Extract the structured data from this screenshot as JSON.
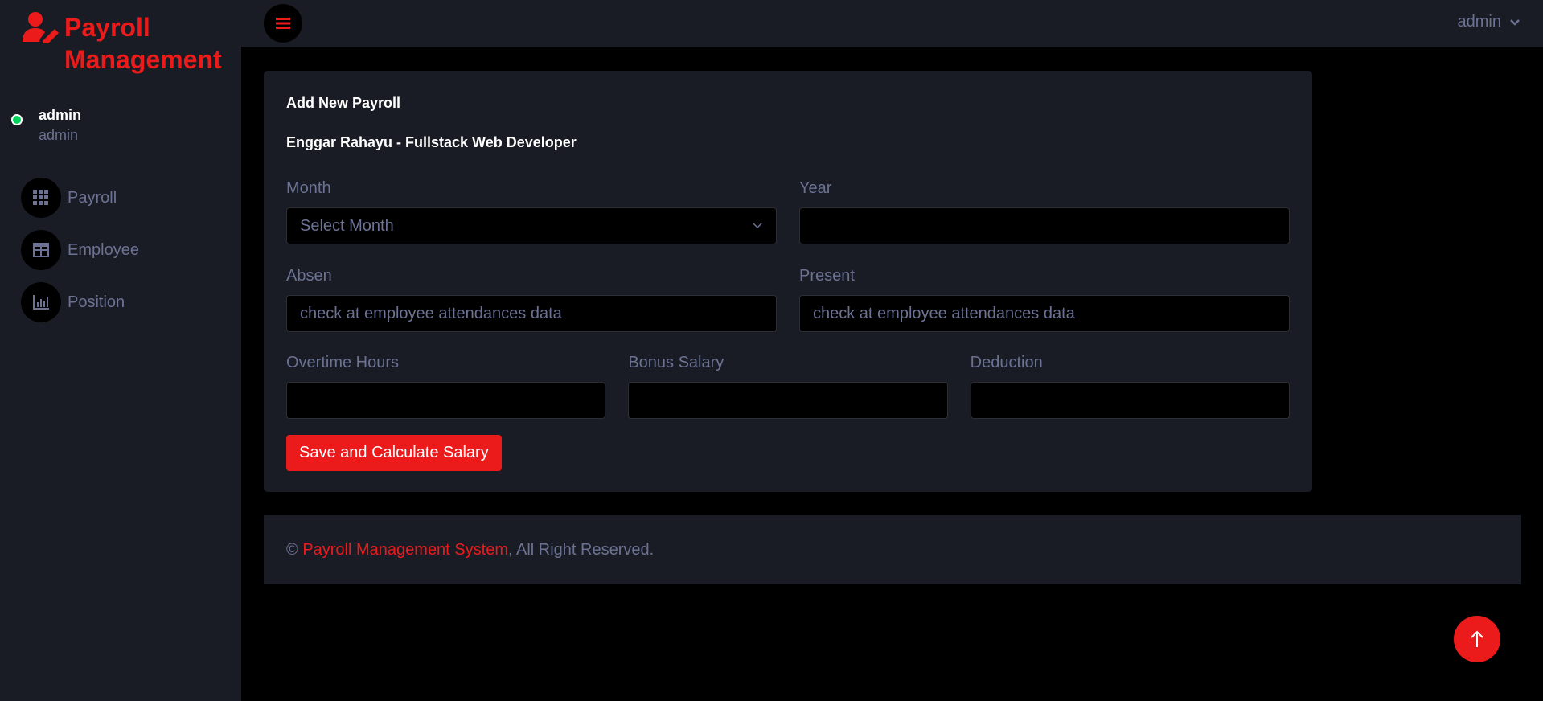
{
  "brand": {
    "title": "Payroll Management"
  },
  "profile": {
    "name": "admin",
    "role": "admin",
    "status_color": "#00d25b"
  },
  "nav": {
    "items": [
      {
        "label": "Payroll",
        "icon": "grid-icon"
      },
      {
        "label": "Employee",
        "icon": "table-icon"
      },
      {
        "label": "Position",
        "icon": "bar-chart-icon"
      }
    ]
  },
  "topbar": {
    "user": "admin"
  },
  "form": {
    "title": "Add New Payroll",
    "employee": "Enggar Rahayu - Fullstack Web Developer",
    "month": {
      "label": "Month",
      "value": "Select Month"
    },
    "year": {
      "label": "Year",
      "value": ""
    },
    "absen": {
      "label": "Absen",
      "placeholder": "check at employee attendances data"
    },
    "present": {
      "label": "Present",
      "placeholder": "check at employee attendances data"
    },
    "overtime": {
      "label": "Overtime Hours",
      "value": ""
    },
    "bonus": {
      "label": "Bonus Salary",
      "value": ""
    },
    "deduction": {
      "label": "Deduction",
      "value": ""
    },
    "submit": "Save and Calculate Salary"
  },
  "footer": {
    "copyright": "©",
    "link": "Payroll Management System",
    "suffix": ", All Right Reserved."
  },
  "colors": {
    "accent": "#ec1b1b",
    "panel": "#191c24",
    "background": "#000000",
    "muted": "#6c7293"
  }
}
